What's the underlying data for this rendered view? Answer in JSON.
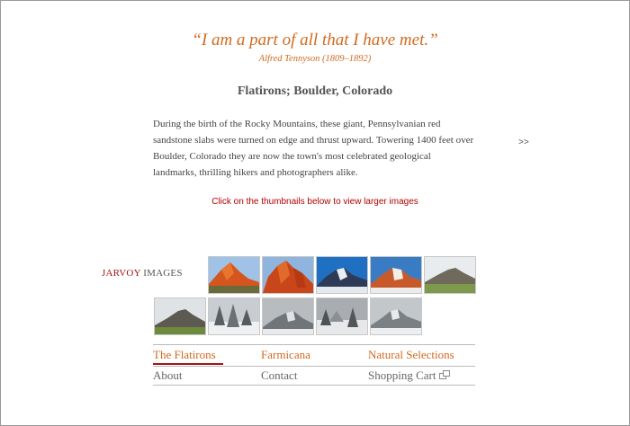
{
  "quote": {
    "text": "“I am a part of all that I have met.”",
    "attribution": "Alfred Tennyson (1809–1892)"
  },
  "heading": "Flatirons; Boulder, Colorado",
  "description": "During the birth of the Rocky Mountains, these giant, Pennsylvanian red sandstone slabs were turned on edge and thrust upward. Towering 1400 feet over Boulder, Colorado they are now the town's most celebrated geological landmarks, thrilling hikers and photographers alike.",
  "next_link": ">>",
  "instruction": "Click on the thumbnails below to view larger images",
  "brand": {
    "part1": "JARVOY",
    "part2": "IMAGES"
  },
  "thumbnails": [
    {
      "id": "sunset-orange-1",
      "style": "orange"
    },
    {
      "id": "sunset-orange-2",
      "style": "orange"
    },
    {
      "id": "snowy-blue-1",
      "style": "blue-snow"
    },
    {
      "id": "snowy-blue-2",
      "style": "blue-dusk"
    },
    {
      "id": "green-meadow-1",
      "style": "green"
    },
    {
      "id": "green-meadow-2",
      "style": "green-dark"
    },
    {
      "id": "snow-trees-1",
      "style": "gray-snow"
    },
    {
      "id": "foggy-1",
      "style": "gray"
    },
    {
      "id": "snow-trees-2",
      "style": "gray-snow"
    },
    {
      "id": "foggy-2",
      "style": "gray"
    }
  ],
  "nav": {
    "primary": [
      {
        "label": "The Flatirons",
        "active": true
      },
      {
        "label": "Farmicana"
      },
      {
        "label": "Natural Selections"
      }
    ],
    "secondary": [
      {
        "label": "About"
      },
      {
        "label": "Contact"
      },
      {
        "label": "Shopping Cart",
        "icon": "external-window-icon"
      }
    ]
  },
  "colors": {
    "accent": "#d2691e",
    "brand_red": "#a31515",
    "instruction_red": "#b30000",
    "text": "#444444"
  }
}
